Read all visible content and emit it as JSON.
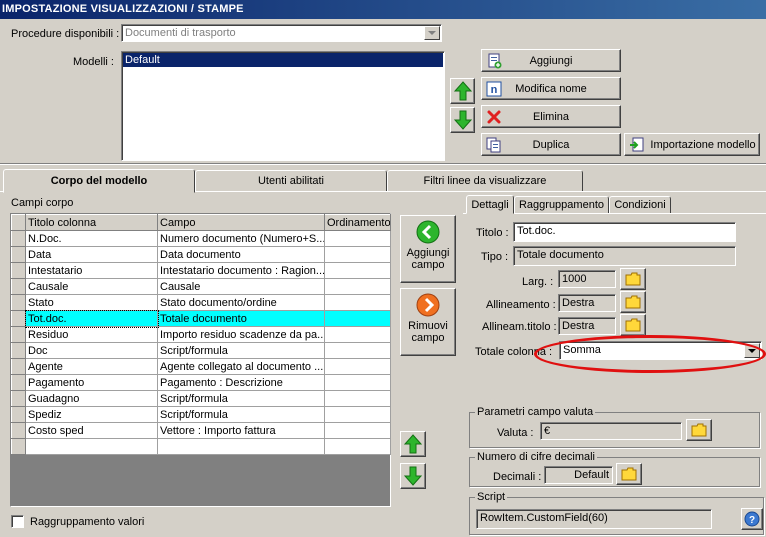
{
  "window": {
    "title": "IMPOSTAZIONE VISUALIZZAZIONI / STAMPE"
  },
  "procedure": {
    "label": "Procedure disponibili :",
    "value": "Documenti di trasporto"
  },
  "modelli": {
    "label": "Modelli :",
    "items": [
      "Default"
    ],
    "selected": "Default"
  },
  "buttons": {
    "aggiungi": "Aggiungi",
    "modifica_nome": "Modifica nome",
    "elimina": "Elimina",
    "duplica": "Duplica",
    "importazione": "Importazione modello"
  },
  "tabs": [
    "Corpo del modello",
    "Utenti abilitati",
    "Filtri linee da visualizzare"
  ],
  "campi_corpo": {
    "label": "Campi corpo",
    "columns": [
      "Titolo colonna",
      "Campo",
      "Ordinamento"
    ],
    "rows": [
      [
        "N.Doc.",
        "Numero documento (Numero+S...",
        ""
      ],
      [
        "Data",
        "Data documento",
        ""
      ],
      [
        "Intestatario",
        "Intestatario documento : Ragion...",
        ""
      ],
      [
        "Causale",
        "Causale",
        ""
      ],
      [
        "Stato",
        "Stato documento/ordine",
        ""
      ],
      [
        "Tot.doc.",
        "Totale documento",
        ""
      ],
      [
        "Residuo",
        "Importo residuo scadenze da pa...",
        ""
      ],
      [
        "Doc",
        "Script/formula",
        ""
      ],
      [
        "Agente",
        "Agente collegato al documento ...",
        ""
      ],
      [
        "Pagamento",
        "Pagamento : Descrizione",
        ""
      ],
      [
        "Guadagno",
        "Script/formula",
        ""
      ],
      [
        "Spediz",
        "Script/formula",
        ""
      ],
      [
        "Costo sped",
        "Vettore : Importo fattura",
        ""
      ]
    ],
    "selected_row": 5
  },
  "side_buttons": {
    "aggiungi_campo": [
      "Aggiungi",
      "campo"
    ],
    "rimuovi_campo": [
      "Rimuovi",
      "campo"
    ]
  },
  "raggruppamento_valori": {
    "label": "Raggruppamento valori",
    "checked": false
  },
  "subtabs": [
    "Dettagli",
    "Raggruppamento",
    "Condizioni"
  ],
  "dettagli": {
    "titolo_label": "Titolo :",
    "titolo": "Tot.doc.",
    "tipo_label": "Tipo :",
    "tipo": "Totale documento",
    "larg_label": "Larg. :",
    "larg": "1000",
    "allineamento_label": "Allineamento :",
    "allineamento": "Destra",
    "allineam_titolo_label": "Allineam.titolo :",
    "allineam_titolo": "Destra",
    "totale_colonna_label": "Totale colonna :",
    "totale_colonna": "Somma"
  },
  "parametri_valuta": {
    "title": "Parametri campo valuta",
    "valuta_label": "Valuta :",
    "valuta": "€"
  },
  "cifre_decimali": {
    "title": "Numero di cifre decimali",
    "decimali_label": "Decimali :",
    "decimali": "Default"
  },
  "script": {
    "title": "Script",
    "value": "RowItem.CustomField(60)"
  },
  "colors": {
    "highlight": "#00ffff",
    "selection": "#0a246a",
    "annotation": "#e01010",
    "arrow_green": "#2db52d"
  }
}
